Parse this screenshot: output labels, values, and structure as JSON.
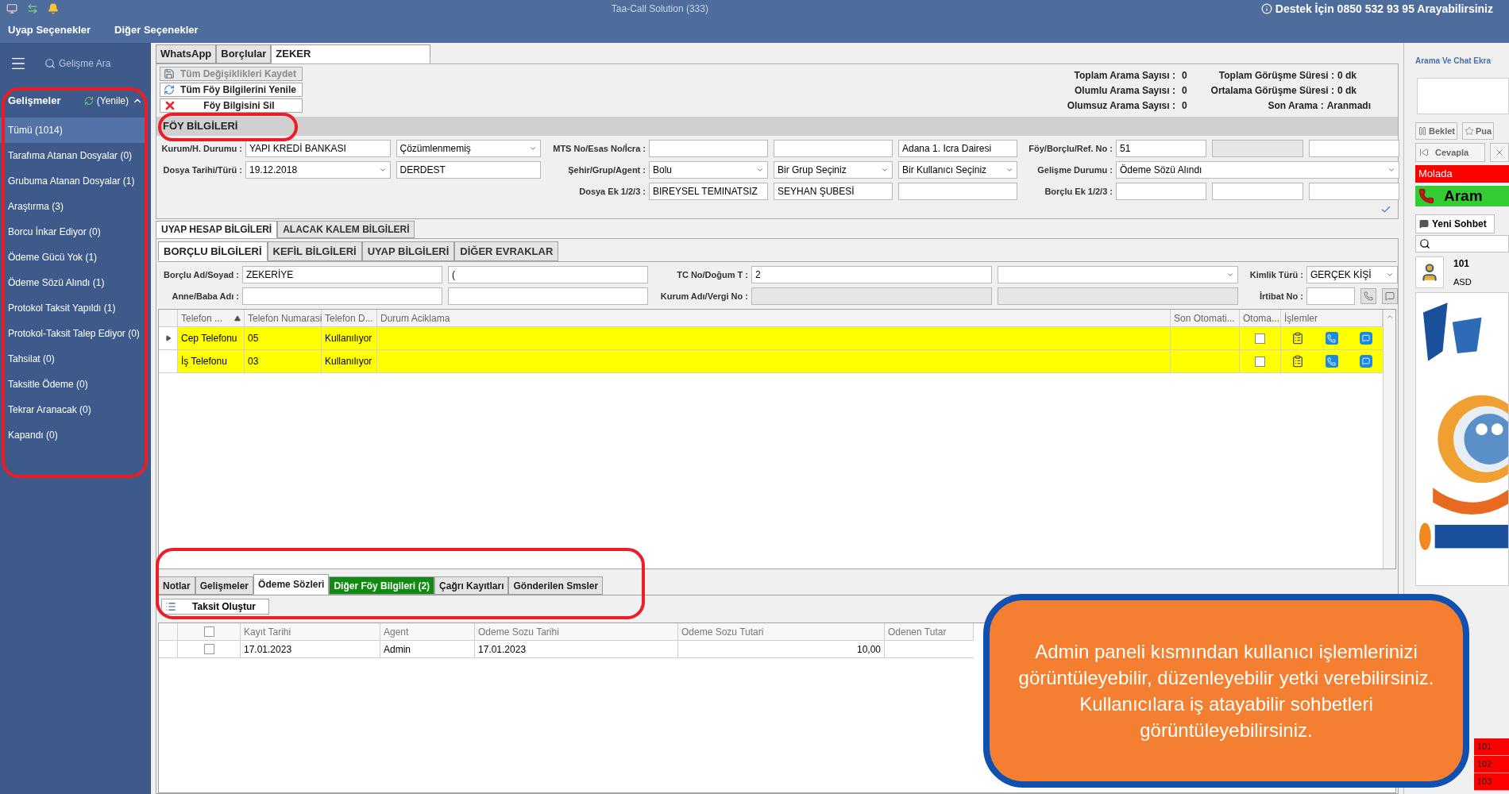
{
  "title_bar": {
    "title": "Taa-Call Solution (333)",
    "support": "Destek İçin 0850 532 93 95 Arayabilirsiniz"
  },
  "menu": [
    "Uyap Seçenekler",
    "Diğer Seçenekler"
  ],
  "sidebar": {
    "search_placeholder": "Gelişme Ara",
    "header": "Gelişmeler",
    "refresh": "(Yenile)",
    "expanded": true,
    "items": [
      {
        "label": "Tümü (1014)",
        "selected": true
      },
      {
        "label": "Tarafıma Atanan Dosyalar (0)",
        "selected": false
      },
      {
        "label": "Grubuma Atanan Dosyalar (1)",
        "selected": false
      },
      {
        "label": "Araştırma (3)",
        "selected": false
      },
      {
        "label": "Borcu İnkar Ediyor (0)",
        "selected": false
      },
      {
        "label": "Ödeme Gücü Yok (1)",
        "selected": false
      },
      {
        "label": "Ödeme Sözü Alındı (1)",
        "selected": false
      },
      {
        "label": "Protokol Taksit Yapıldı (1)",
        "selected": false
      },
      {
        "label": "Protokol-Taksit Talep Ediyor (0)",
        "selected": false
      },
      {
        "label": "Tahsilat (0)",
        "selected": false
      },
      {
        "label": "Taksitle Ödeme (0)",
        "selected": false
      },
      {
        "label": "Tekrar Aranacak (0)",
        "selected": false
      },
      {
        "label": "Kapandı (0)",
        "selected": false
      }
    ]
  },
  "doc_tabs": [
    {
      "label": "WhatsApp",
      "selected": false
    },
    {
      "label": "Borçlular",
      "selected": false
    },
    {
      "label": "ZEKER",
      "selected": true
    }
  ],
  "toolbar": [
    {
      "label": "Tüm Değişiklikleri Kaydet",
      "kind": "save",
      "disabled": true
    },
    {
      "label": "Tüm Föy Bilgilerini Yenile",
      "kind": "refresh",
      "disabled": false
    },
    {
      "label": "Föy Bilgisini Sil",
      "kind": "delete",
      "disabled": false
    }
  ],
  "stats": [
    {
      "left_label": "Toplam Arama Sayısı :",
      "left_value": "0",
      "right_label": "Toplam Görüşme Süresi :",
      "right_value": "0 dk"
    },
    {
      "left_label": "Olumlu Arama Sayısı :",
      "left_value": "0",
      "right_label": "Ortalama Görüşme Süresi :",
      "right_value": "0 dk"
    },
    {
      "left_label": "Olumsuz Arama Sayısı :",
      "left_value": "0",
      "right_label": "Son Arama :",
      "right_value": "Aranmadı"
    }
  ],
  "section_title": "FÖY BİLGİLERİ",
  "foy_form": [
    [
      {
        "label": "Kurum/H. Durumu :",
        "fields": [
          {
            "kind": "text",
            "value": "YAPI KREDİ BANKASI"
          },
          {
            "kind": "select",
            "value": "Çözümlenmemiş"
          }
        ]
      },
      {
        "label": "MTS No/Esas No/İcra :",
        "fields": [
          {
            "kind": "text"
          },
          {
            "kind": "text"
          },
          {
            "kind": "text",
            "value": "Adana 1. Icra Dairesi"
          }
        ]
      },
      {
        "label": "Föy/Borçlu/Ref. No :",
        "fields": [
          {
            "kind": "text",
            "value": "51"
          },
          {
            "kind": "readonly"
          },
          {
            "kind": "text"
          }
        ]
      }
    ],
    [
      {
        "label": "Dosya Tarihi/Türü :",
        "fields": [
          {
            "kind": "select",
            "value": "19.12.2018"
          },
          {
            "kind": "text",
            "value": "DERDEST"
          }
        ]
      },
      {
        "label": "Şehir/Grup/Agent :",
        "fields": [
          {
            "kind": "select",
            "value": "Bolu"
          },
          {
            "kind": "select",
            "value": "Bir Grup Seçiniz"
          },
          {
            "kind": "select",
            "value": "Bir Kullanıcı Seçiniz"
          }
        ]
      },
      {
        "label": "Gelişme Durumu :",
        "fields": [
          {
            "kind": "select",
            "value": "Ödeme Sözü Alındı"
          }
        ]
      }
    ],
    [
      {
        "label": "Dosya Ek 1/2/3 :",
        "fields": [
          {
            "kind": "text",
            "value": "BIREYSEL TEMINATSIZ"
          },
          {
            "kind": "text",
            "value": "SEYHAN ŞUBESİ"
          },
          {
            "kind": "text"
          }
        ]
      },
      {
        "label": "Borçlu Ek 1/2/3 :",
        "fields": [
          {
            "kind": "text"
          },
          {
            "kind": "text"
          },
          {
            "kind": "text"
          }
        ]
      }
    ]
  ],
  "info_tabs": [
    {
      "label": "UYAP HESAP BİLGİLERİ",
      "selected": true
    },
    {
      "label": "ALACAK KALEM BİLGİLERİ",
      "selected": false
    }
  ],
  "party_tabs": [
    {
      "label": "BORÇLU BİLGİLERİ",
      "selected": true
    },
    {
      "label": "KEFİL BİLGİLERİ",
      "selected": false
    },
    {
      "label": "UYAP BİLGİLERİ",
      "selected": false
    },
    {
      "label": "DİĞER EVRAKLAR",
      "selected": false
    }
  ],
  "debtor_form": [
    [
      {
        "label": "Borçlu Ad/Soyad :",
        "fields": [
          {
            "kind": "text",
            "value": "ZEKERİYE"
          },
          {
            "kind": "text",
            "value": "("
          }
        ]
      },
      {
        "label": "TC No/Doğum T :",
        "fields": [
          {
            "kind": "text",
            "value": "2"
          },
          {
            "kind": "select"
          }
        ]
      },
      {
        "label": "Kimlik Türü :",
        "fields": [
          {
            "kind": "select",
            "value": "GERÇEK KİŞİ"
          }
        ]
      }
    ],
    [
      {
        "label": "Anne/Baba Adı :",
        "fields": [
          {
            "kind": "text"
          },
          {
            "kind": "text"
          }
        ]
      },
      {
        "label": "Kurum Adı/Vergi No :",
        "fields": [
          {
            "kind": "readonly"
          },
          {
            "kind": "readonly"
          }
        ]
      },
      {
        "label": "İrtibat No :",
        "fields": [
          {
            "kind": "text"
          },
          {
            "kind": "call_button"
          },
          {
            "kind": "sms_button"
          }
        ]
      }
    ]
  ],
  "phones": {
    "columns": [
      "Telefon ...",
      "Telefon Numarasi",
      "Telefon D...",
      "Durum Aciklama",
      "Son Otomati...",
      "Otoma...",
      "İşlemler"
    ],
    "rows": [
      {
        "type": "Cep Telefonu",
        "number": "05",
        "status": "Kullanılıyor",
        "current": true,
        "highlighted": true,
        "auto": false
      },
      {
        "type": "İş Telefonu",
        "number": "03",
        "status": "Kullanılıyor",
        "current": false,
        "highlighted": true,
        "auto": false
      }
    ]
  },
  "bottom_tabs": [
    {
      "label": "Notlar",
      "selected": false,
      "highlighted": false
    },
    {
      "label": "Gelişmeler",
      "selected": false,
      "highlighted": false
    },
    {
      "label": "Ödeme Sözleri",
      "selected": true,
      "highlighted": false
    },
    {
      "label": "Diğer Föy Bilgileri (2)",
      "selected": false,
      "highlighted": true
    },
    {
      "label": "Çağrı Kayıtları",
      "selected": false,
      "highlighted": false
    },
    {
      "label": "Gönderilen Smsler",
      "selected": false,
      "highlighted": false
    }
  ],
  "taksit_button": "Taksit Oluştur",
  "promises": {
    "columns": [
      "Kayıt Tarihi",
      "Agent",
      "Odeme Sozu Tarihi",
      "Odeme Sozu Tutari",
      "Odenen Tutar"
    ],
    "header_checked": false,
    "rows": [
      {
        "checked": false,
        "cells": [
          "17.01.2023",
          "Admin",
          "17.01.2023",
          "10,00"
        ]
      }
    ]
  },
  "right_panel": {
    "title": "Arama Ve Chat Ekra",
    "buttons": [
      "Beklet",
      "Pua"
    ],
    "answer": "Cevapla",
    "status": "Molada",
    "call": "Aram",
    "new_chat": "Yeni Sohbet",
    "contact": {
      "number": "101",
      "name": "ASD"
    },
    "extensions": [
      "101",
      "102",
      "103"
    ]
  },
  "callout": "Admin paneli kısmından kullanıcı işlemlerinizi görüntüleyebilir, düzenleyebilir yetki verebilirsiniz. Kullanıcılara iş atayabilir sohbetleri görüntüleyebilirsiniz."
}
